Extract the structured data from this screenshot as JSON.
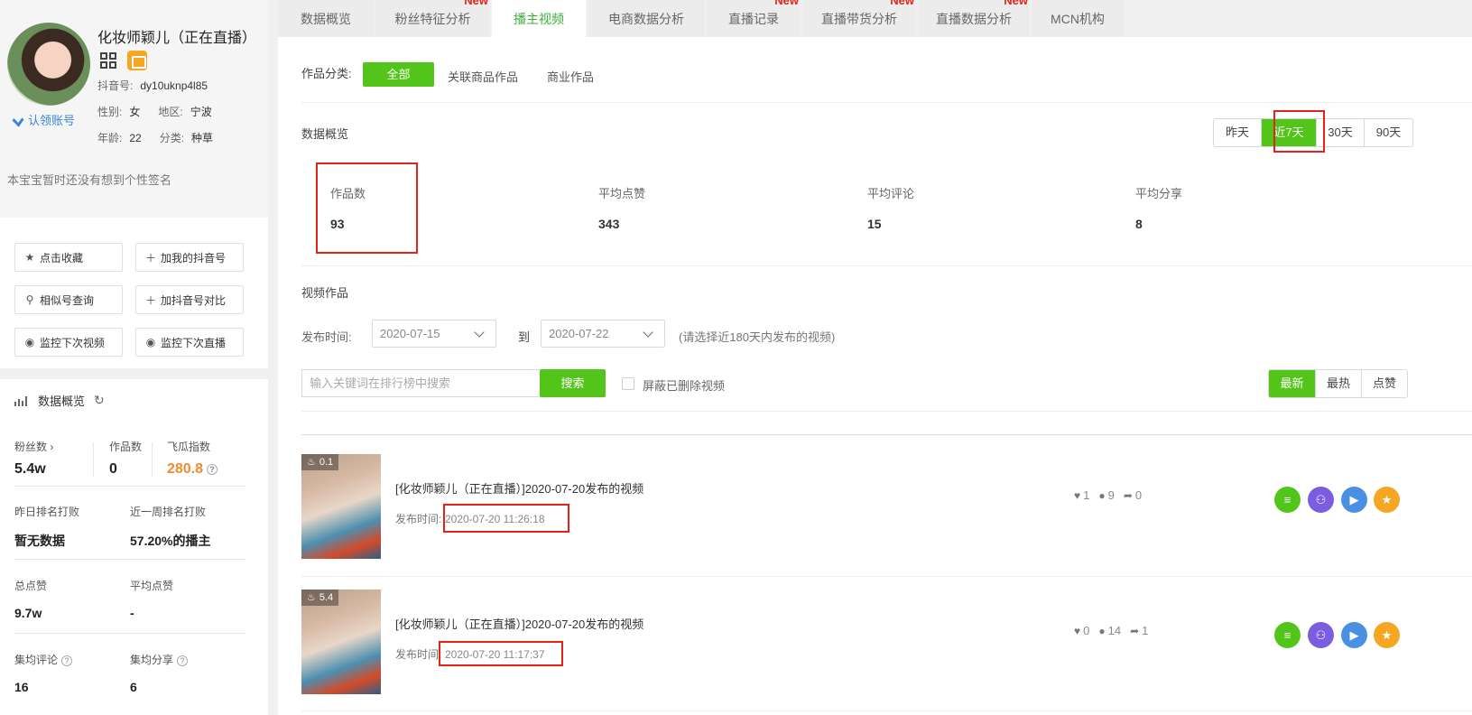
{
  "profile": {
    "name": "化妆师颖儿（正在直播）",
    "douyin_label": "抖音号:",
    "douyin_id": "dy10uknp4l85",
    "gender_label": "性别:",
    "gender": "女",
    "region_label": "地区:",
    "region": "宁波",
    "age_label": "年龄:",
    "age": "22",
    "category_label": "分类:",
    "category": "种草",
    "claim_label": "认领账号",
    "bio": "本宝宝暂时还没有想到个性签名"
  },
  "actions": [
    {
      "label": "点击收藏",
      "icon": "star-icon"
    },
    {
      "label": "加我的抖音号",
      "icon": "plus-icon"
    },
    {
      "label": "相似号查询",
      "icon": "search-icon"
    },
    {
      "label": "加抖音号对比",
      "icon": "plus-icon"
    },
    {
      "label": "监控下次视频",
      "icon": "eye-icon"
    },
    {
      "label": "监控下次直播",
      "icon": "eye-icon"
    }
  ],
  "overview": {
    "title": "数据概览",
    "fans_label": "粉丝数",
    "fans_value": "5.4w",
    "works_label": "作品数",
    "works_value": "0",
    "feigua_label": "飞瓜指数",
    "feigua_value": "280.8",
    "yesterday_rank_label": "昨日排名打败",
    "yesterday_rank_value": "暂无数据",
    "week_rank_label": "近一周排名打败",
    "week_rank_value": "57.20%的播主",
    "total_likes_label": "总点赞",
    "total_likes_value": "9.7w",
    "avg_likes_label": "平均点赞",
    "avg_likes_value": "-",
    "avg_comments_label": "集均评论",
    "avg_comments_value": "16",
    "avg_shares_label": "集均分享",
    "avg_shares_value": "6"
  },
  "tabs": [
    {
      "label": "数据概览",
      "new": ""
    },
    {
      "label": "粉丝特征分析",
      "new": "New"
    },
    {
      "label": "播主视频",
      "new": ""
    },
    {
      "label": "电商数据分析",
      "new": ""
    },
    {
      "label": "直播记录",
      "new": "New"
    },
    {
      "label": "直播带货分析",
      "new": "New"
    },
    {
      "label": "直播数据分析",
      "new": "New"
    },
    {
      "label": "MCN机构",
      "new": ""
    }
  ],
  "category_filter": {
    "label": "作品分类:",
    "options": [
      "全部",
      "关联商品作品",
      "商业作品"
    ]
  },
  "data_overview": {
    "title": "数据概览",
    "ranges": [
      "昨天",
      "近7天",
      "30天",
      "90天"
    ],
    "stats": [
      {
        "label": "作品数",
        "value": "93"
      },
      {
        "label": "平均点赞",
        "value": "343"
      },
      {
        "label": "平均评论",
        "value": "15"
      },
      {
        "label": "平均分享",
        "value": "8"
      }
    ]
  },
  "videos_section": {
    "title": "视频作品",
    "publish_label": "发布时间:",
    "date_from": "2020-07-15",
    "to_label": "到",
    "date_to": "2020-07-22",
    "hint": "(请选择近180天内发布的视频)",
    "search_placeholder": "输入关键词在排行榜中搜索",
    "search_button": "搜索",
    "hide_deleted_label": "屏蔽已删除视频",
    "sort_options": [
      "最新",
      "最热",
      "点赞"
    ]
  },
  "videos": [
    {
      "heat": "0.1",
      "title": "[化妆师颖儿（正在直播）]2020-07-20发布的视频",
      "time_label": "发布时间:",
      "time": "2020-07-20 11:26:18",
      "likes": "1",
      "comments": "9",
      "shares": "0"
    },
    {
      "heat": "5.4",
      "title": "[化妆师颖儿（正在直播）]2020-07-20发布的视频",
      "time_label": "发布时间:",
      "time": "2020-07-20 11:17:37",
      "likes": "0",
      "comments": "14",
      "shares": "1"
    }
  ],
  "colors": {
    "accent": "#52c41a",
    "tab_active": "#3dad3d",
    "new_badge": "#e2231a",
    "feigua": "#f08c2e",
    "link": "#3a86d6",
    "highlight_box": "#e2231a"
  }
}
